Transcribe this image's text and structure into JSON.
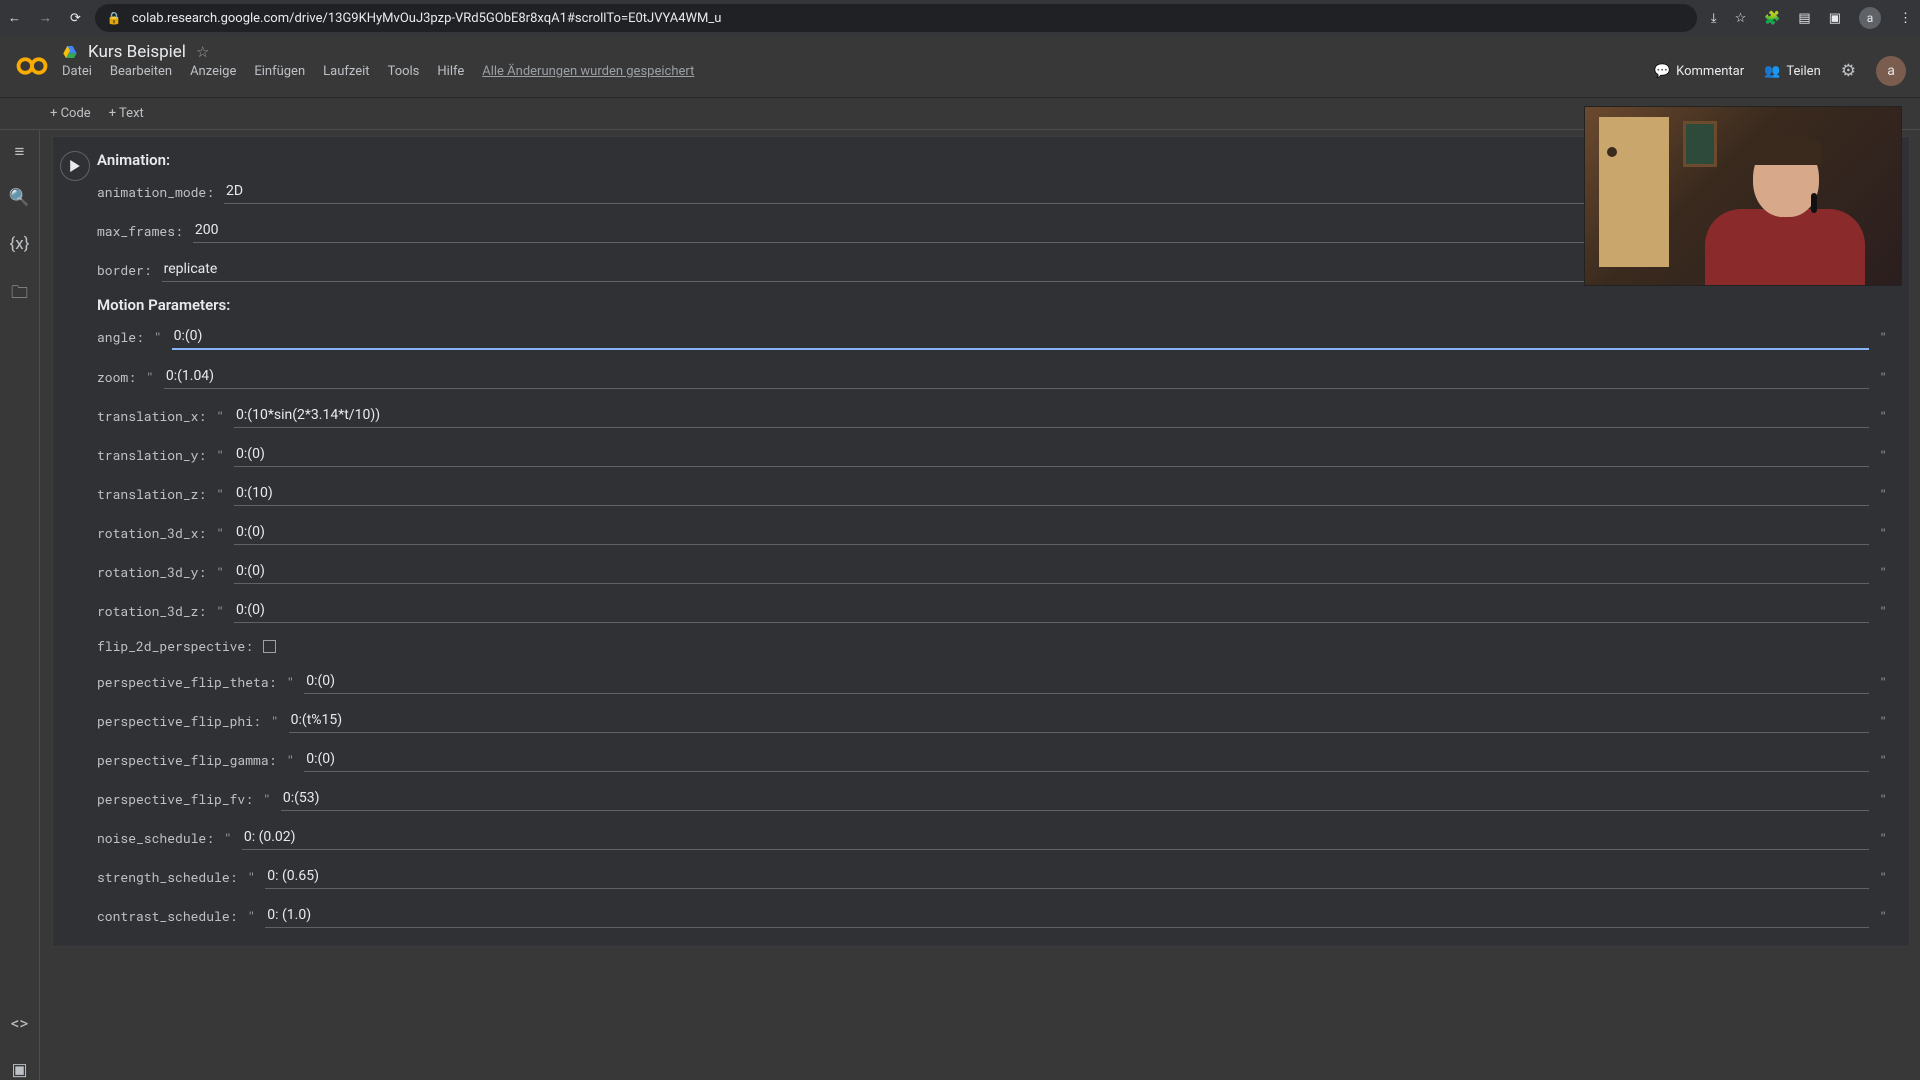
{
  "browser": {
    "url": "colab.research.google.com/drive/13G9KHyMvOuJ3pzp-VRd5GObE8r8xqA1#scrollTo=E0tJVYA4WM_u",
    "avatar_letter": "a"
  },
  "header": {
    "title": "Kurs Beispiel",
    "menus": [
      "Datei",
      "Bearbeiten",
      "Anzeige",
      "Einfügen",
      "Laufzeit",
      "Tools",
      "Hilfe"
    ],
    "saved_msg": "Alle Änderungen wurden gespeichert",
    "comment": "Kommentar",
    "share": "Teilen",
    "avatar_letter": "a"
  },
  "toolbar": {
    "code": "+ Code",
    "text": "+ Text"
  },
  "form": {
    "section_animation": "Animation:",
    "section_motion": "Motion Parameters:",
    "animation_mode": {
      "label": "animation_mode:",
      "value": "2D"
    },
    "max_frames": {
      "label": "max_frames:",
      "value": "200"
    },
    "border": {
      "label": "border:",
      "value": "replicate"
    },
    "angle": {
      "label": "angle:",
      "value": "0:(0)"
    },
    "zoom": {
      "label": "zoom:",
      "value": "0:(1.04)"
    },
    "translation_x": {
      "label": "translation_x:",
      "value": "0:(10*sin(2*3.14*t/10))"
    },
    "translation_y": {
      "label": "translation_y:",
      "value": "0:(0)"
    },
    "translation_z": {
      "label": "translation_z:",
      "value": "0:(10)"
    },
    "rotation_3d_x": {
      "label": "rotation_3d_x:",
      "value": "0:(0)"
    },
    "rotation_3d_y": {
      "label": "rotation_3d_y:",
      "value": "0:(0)"
    },
    "rotation_3d_z": {
      "label": "rotation_3d_z:",
      "value": "0:(0)"
    },
    "flip_2d_perspective": {
      "label": "flip_2d_perspective:",
      "checked": false
    },
    "perspective_flip_theta": {
      "label": "perspective_flip_theta:",
      "value": "0:(0)"
    },
    "perspective_flip_phi": {
      "label": "perspective_flip_phi:",
      "value": "0:(t%15)"
    },
    "perspective_flip_gamma": {
      "label": "perspective_flip_gamma:",
      "value": "0:(0)"
    },
    "perspective_flip_fv": {
      "label": "perspective_flip_fv:",
      "value": "0:(53)"
    },
    "noise_schedule": {
      "label": "noise_schedule:",
      "value": "0: (0.02)"
    },
    "strength_schedule": {
      "label": "strength_schedule:",
      "value": "0: (0.65)"
    },
    "contrast_schedule": {
      "label": "contrast_schedule:",
      "value": "0: (1.0)"
    }
  }
}
